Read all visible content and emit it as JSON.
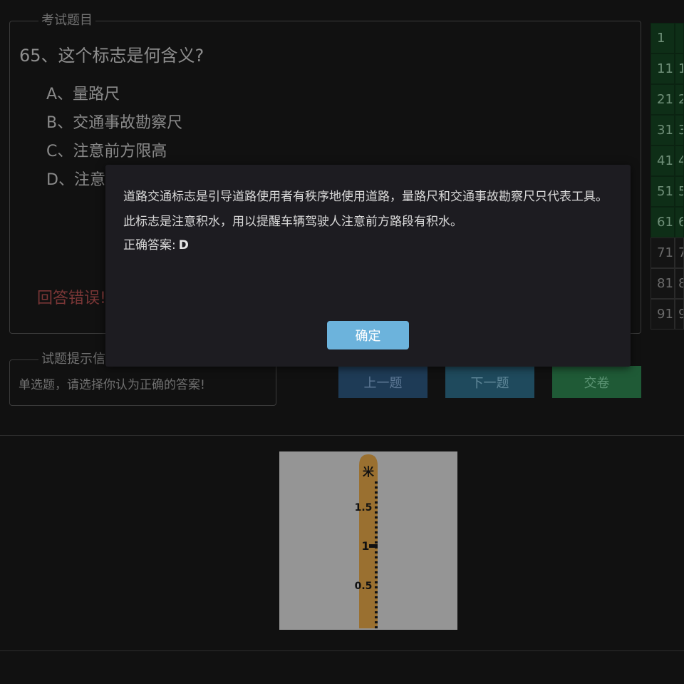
{
  "question_box": {
    "legend": "考试题目",
    "title": "65、这个标志是何含义?",
    "options": [
      "A、量路尺",
      "B、交通事故勘察尺",
      "C、注意前方限高",
      "D、注意"
    ],
    "result": "回答错误!"
  },
  "hint_box": {
    "legend": "试题提示信",
    "text": "单选题，请选择你认为正确的答案!"
  },
  "buttons": {
    "prev": "上一题",
    "next": "下一题",
    "submit": "交卷"
  },
  "grid": {
    "rows": [
      {
        "num": "1",
        "next": "",
        "done": true
      },
      {
        "num": "11",
        "next": "1",
        "done": true
      },
      {
        "num": "21",
        "next": "2",
        "done": true
      },
      {
        "num": "31",
        "next": "3",
        "done": true
      },
      {
        "num": "41",
        "next": "4",
        "done": true
      },
      {
        "num": "51",
        "next": "5",
        "done": true
      },
      {
        "num": "61",
        "next": "6",
        "done": true
      },
      {
        "num": "71",
        "next": "7",
        "done": false
      },
      {
        "num": "81",
        "next": "8",
        "done": false
      },
      {
        "num": "91",
        "next": "9",
        "done": false
      }
    ]
  },
  "sign": {
    "unit_label": "米",
    "tick_labels": [
      "1.5",
      "1",
      "0.5"
    ]
  },
  "modal": {
    "explanation": "道路交通标志是引导道路使用者有秩序地使用道路，量路尺和交通事故勘察尺只代表工具。此标志是注意积水，用以提醒车辆驾驶人注意前方路段有积水。",
    "answer_label": "正确答案:",
    "answer_value": "D",
    "ok_label": "确定"
  }
}
